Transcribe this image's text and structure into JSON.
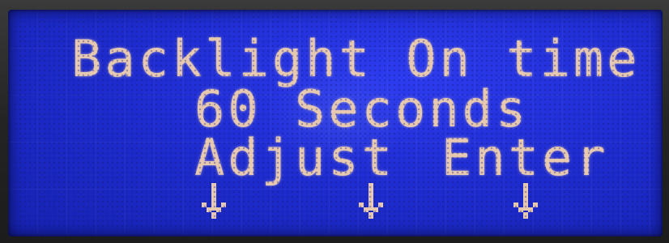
{
  "display": {
    "line1": "Backlight On time",
    "line2": "60 Seconds",
    "line3_left": "Adjust",
    "line3_right": "Enter"
  },
  "icons": [
    "down-arrow-icon",
    "down-arrow-icon",
    "down-arrow-icon"
  ],
  "colors": {
    "lcd_background": "#1f2dd2",
    "pixel_text": "#e6c9b0",
    "bezel": "#242424"
  }
}
